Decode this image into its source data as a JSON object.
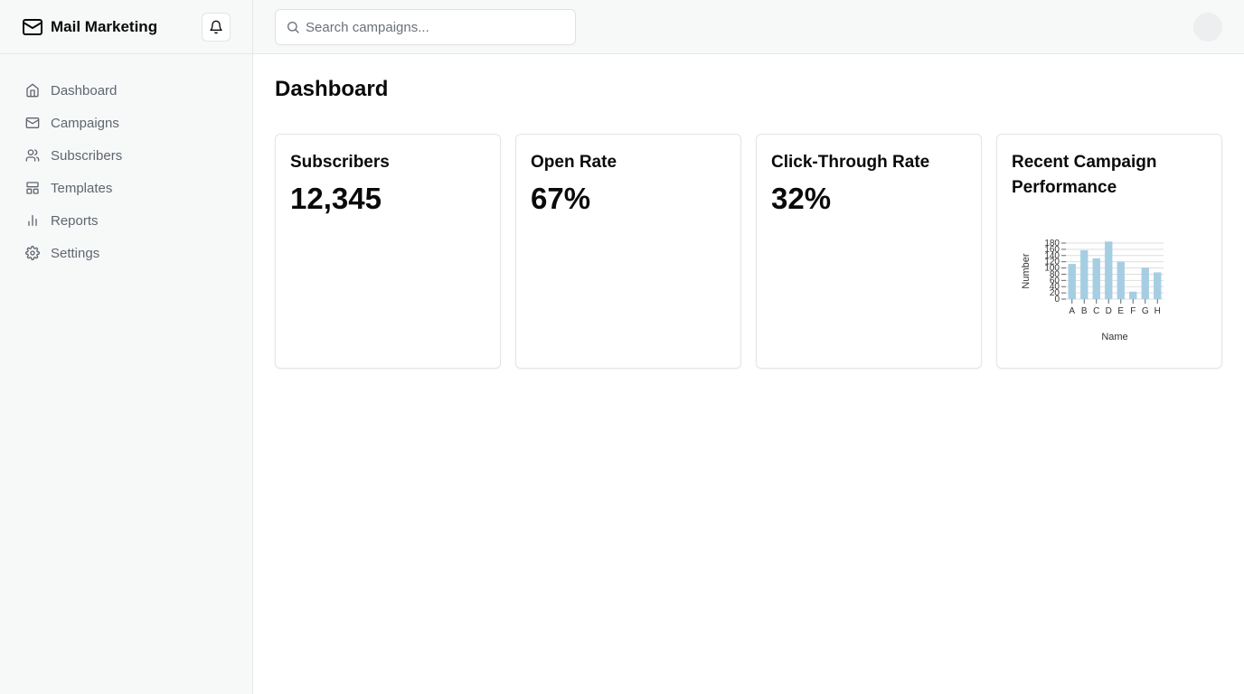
{
  "app": {
    "title": "Mail Marketing"
  },
  "sidebar": {
    "items": [
      {
        "label": "Dashboard",
        "icon": "home-icon"
      },
      {
        "label": "Campaigns",
        "icon": "mail-icon"
      },
      {
        "label": "Subscribers",
        "icon": "users-icon"
      },
      {
        "label": "Templates",
        "icon": "layout-icon"
      },
      {
        "label": "Reports",
        "icon": "bar-chart-icon"
      },
      {
        "label": "Settings",
        "icon": "gear-icon"
      }
    ]
  },
  "search": {
    "placeholder": "Search campaigns..."
  },
  "page": {
    "title": "Dashboard"
  },
  "cards": [
    {
      "title": "Subscribers",
      "value": "12,345"
    },
    {
      "title": "Open Rate",
      "value": "67%"
    },
    {
      "title": "Click-Through Rate",
      "value": "32%"
    },
    {
      "title": "Recent Campaign Performance"
    }
  ],
  "chart_data": {
    "type": "bar",
    "categories": [
      "A",
      "B",
      "C",
      "D",
      "E",
      "F",
      "G",
      "H"
    ],
    "values": [
      113,
      157,
      131,
      185,
      120,
      24,
      101,
      86
    ],
    "xlabel": "Name",
    "ylabel": "Number",
    "yticks": [
      0,
      20,
      40,
      60,
      80,
      100,
      120,
      140,
      160,
      180
    ],
    "ylim": [
      0,
      180
    ],
    "grid": true,
    "bar_color": "#a6cee3"
  },
  "colors": {
    "sidebar_bg": "#f7f8f8",
    "border": "#e5e7e8",
    "nav_text": "#5f6670",
    "bar": "#a6cee3"
  }
}
